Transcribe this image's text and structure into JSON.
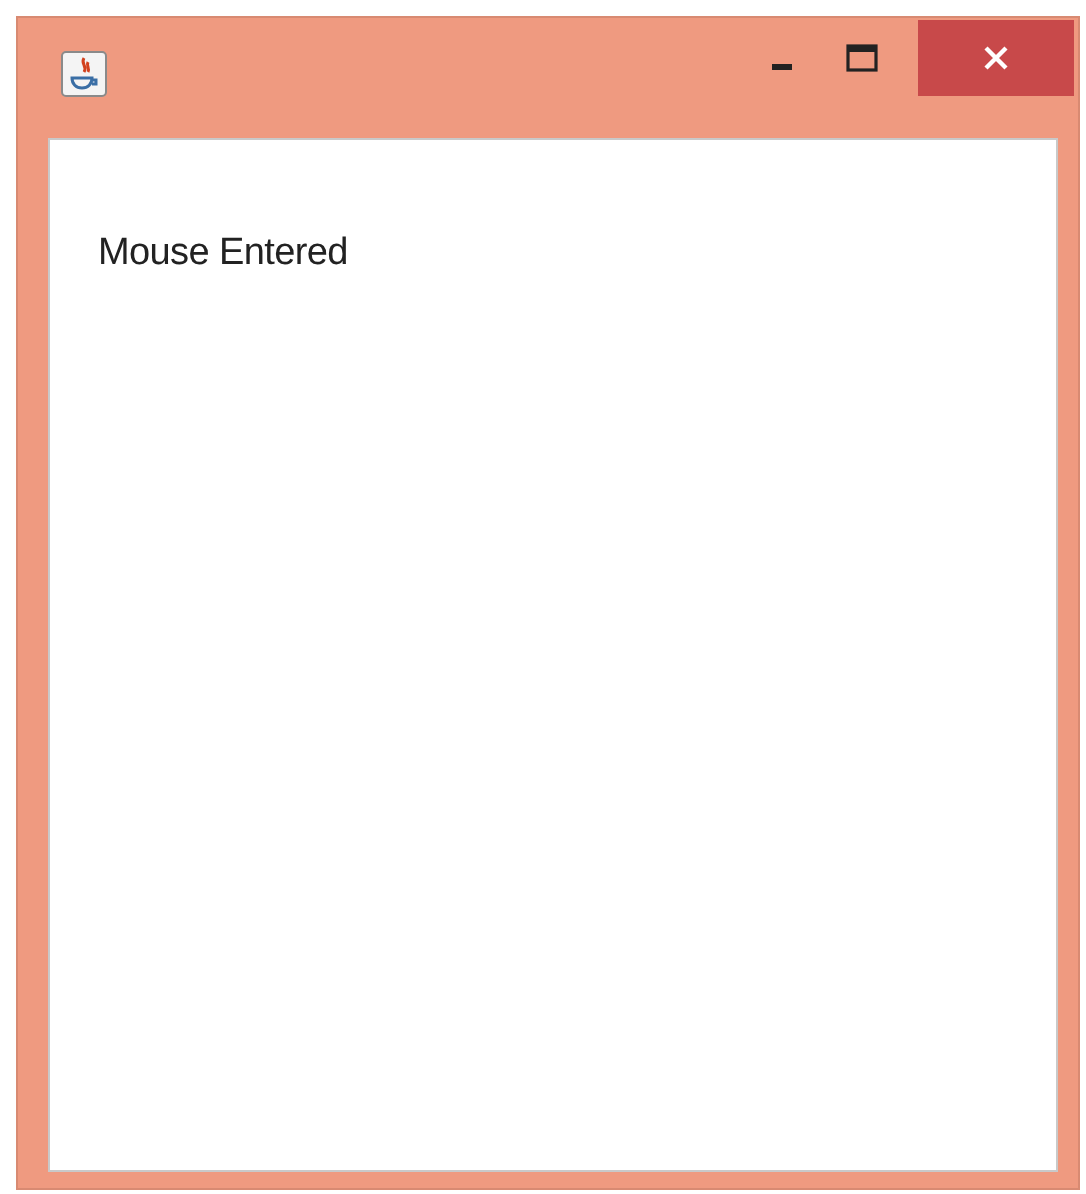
{
  "window": {
    "label": "Mouse Entered"
  }
}
